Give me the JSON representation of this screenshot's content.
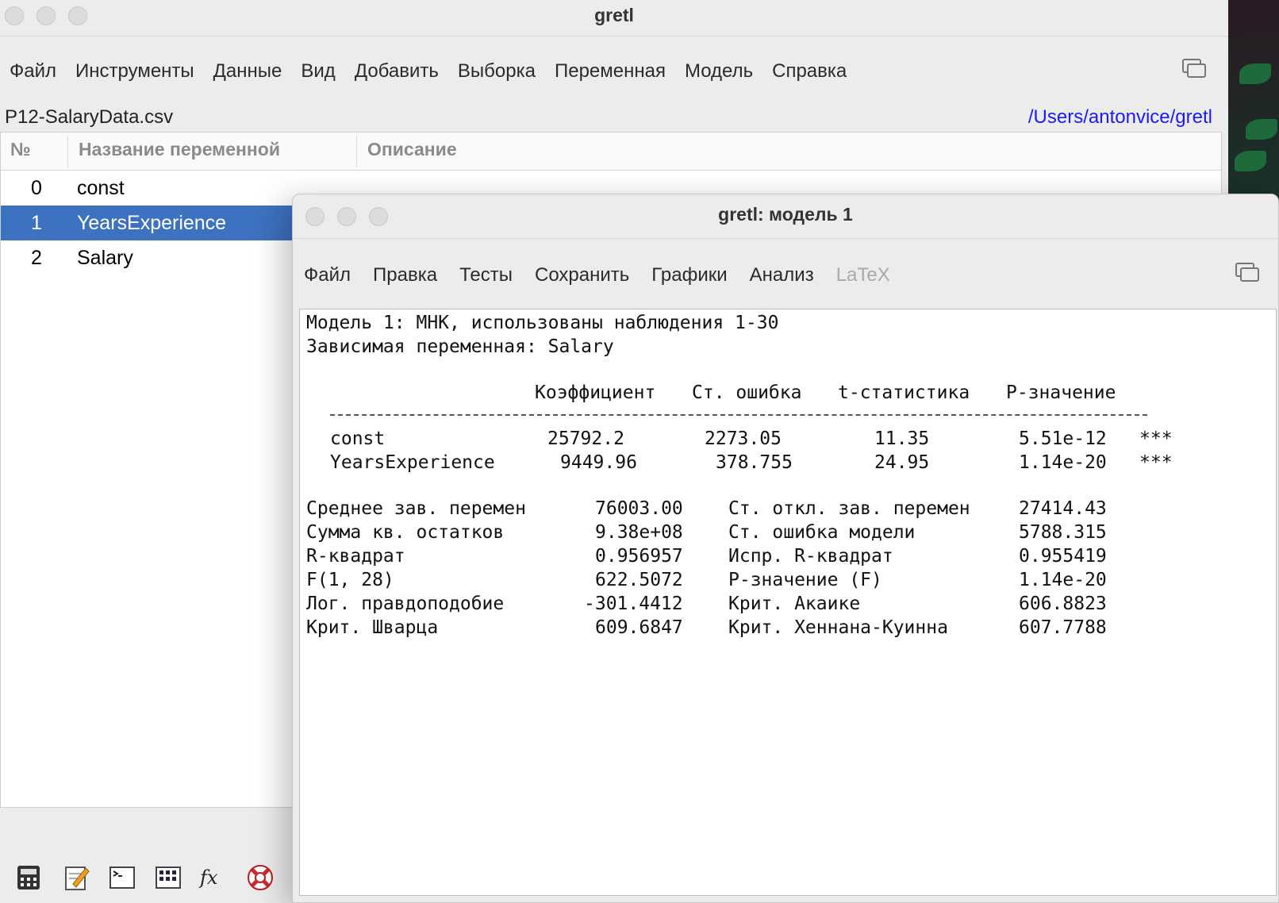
{
  "main_window": {
    "title": "gretl",
    "menu": [
      "Файл",
      "Инструменты",
      "Данные",
      "Вид",
      "Добавить",
      "Выборка",
      "Переменная",
      "Модель",
      "Справка"
    ],
    "file_name": "P12-SalaryData.csv",
    "path": "/Users/antonvice/gretl",
    "table": {
      "columns": [
        "№",
        "Название переменной",
        "Описание"
      ],
      "rows": [
        {
          "num": "0",
          "name": "const",
          "selected": false
        },
        {
          "num": "1",
          "name": "YearsExperience",
          "selected": true
        },
        {
          "num": "2",
          "name": "Salary",
          "selected": false
        }
      ]
    },
    "toolbar_icons": [
      "calculator-icon",
      "notepad-icon",
      "terminal-icon",
      "matrix-icon",
      "function-fx-icon",
      "lifebuoy-icon"
    ],
    "fx_label": "fx"
  },
  "model_window": {
    "title": "gretl: модель 1",
    "menu": [
      {
        "label": "Файл",
        "enabled": true
      },
      {
        "label": "Правка",
        "enabled": true
      },
      {
        "label": "Тесты",
        "enabled": true
      },
      {
        "label": "Сохранить",
        "enabled": true
      },
      {
        "label": "Графики",
        "enabled": true
      },
      {
        "label": "Анализ",
        "enabled": true
      },
      {
        "label": "LaTeX",
        "enabled": false
      }
    ],
    "output": {
      "line1": "Модель 1: МНК, использованы наблюдения 1-30",
      "line2": "Зависимая переменная: Salary",
      "headers": [
        "Коэффициент",
        "Ст. ошибка",
        "t-статистика",
        "P-значение"
      ],
      "coefficients": [
        {
          "var": "const",
          "coef": "25792.2",
          "se": "2273.05",
          "t": "11.35",
          "p": "5.51e-12",
          "stars": "***"
        },
        {
          "var": "YearsExperience",
          "coef": "9449.96",
          "se": "378.755",
          "t": "24.95",
          "p": "1.14e-20",
          "stars": "***"
        }
      ],
      "stats": [
        {
          "l1": "Среднее зав. перемен",
          "v1": "76003.00",
          "l2": "Ст. откл. зав. перемен",
          "v2": "27414.43"
        },
        {
          "l1": "Сумма кв. остатков",
          "v1": "9.38e+08",
          "l2": "Ст. ошибка модели",
          "v2": "5788.315"
        },
        {
          "l1": "R-квадрат",
          "v1": "0.956957",
          "l2": "Испр. R-квадрат",
          "v2": "0.955419"
        },
        {
          "l1": "F(1, 28)",
          "v1": "622.5072",
          "l2": "P-значение (F)",
          "v2": "1.14e-20"
        },
        {
          "l1": "Лог. правдоподобие",
          "v1": "-301.4412",
          "l2": "Крит. Акаике",
          "v2": "606.8823"
        },
        {
          "l1": "Крит. Шварца",
          "v1": "609.6847",
          "l2": "Крит. Хеннана-Куинна",
          "v2": "607.7788"
        }
      ]
    }
  },
  "colors": {
    "selection": "#3d72c0",
    "path_link": "#1a1aff",
    "disabled_menu": "#a9a9a9"
  }
}
